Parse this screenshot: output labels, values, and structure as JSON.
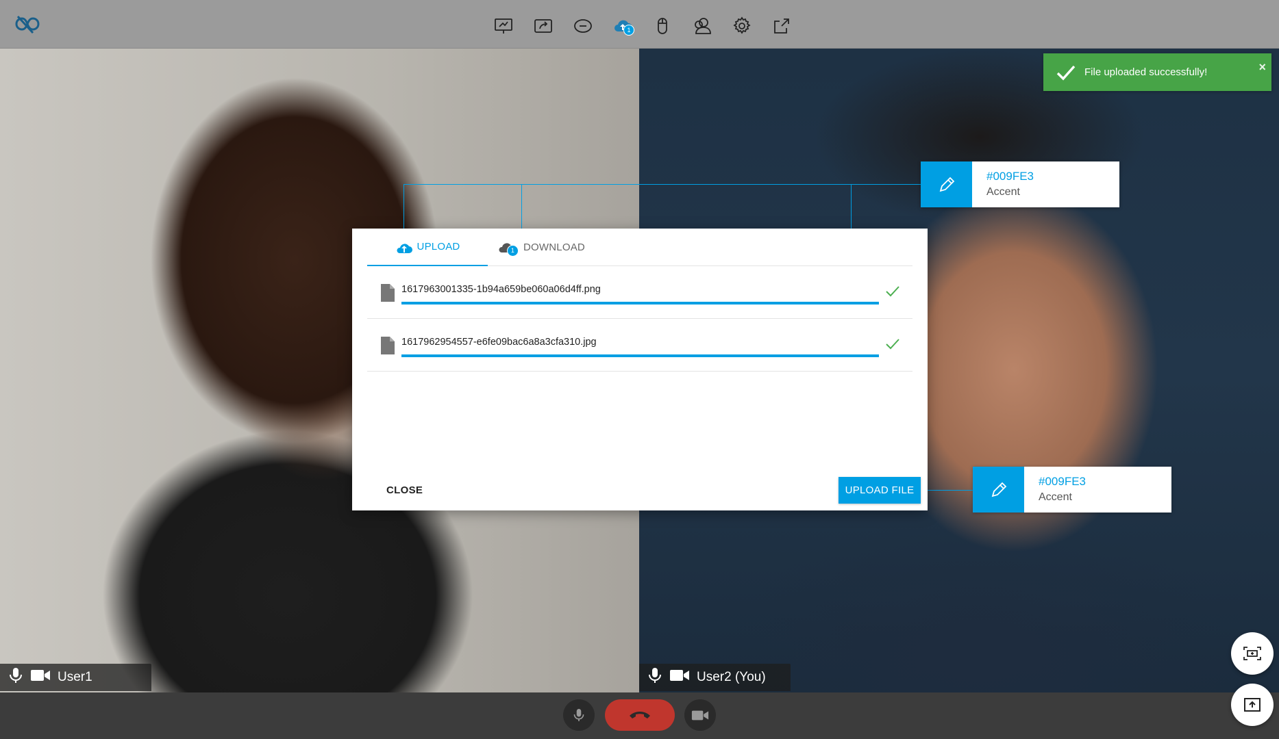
{
  "toolbar": {
    "tools": [
      {
        "name": "whiteboard-icon"
      },
      {
        "name": "share-screen-icon"
      },
      {
        "name": "chat-icon"
      },
      {
        "name": "file-transfer-icon",
        "badge": "1"
      },
      {
        "name": "mouse-icon"
      },
      {
        "name": "participants-icon"
      },
      {
        "name": "settings-icon"
      },
      {
        "name": "fullscreen-icon"
      }
    ]
  },
  "toast": {
    "message": "File uploaded successfully!",
    "close": "×"
  },
  "participants": [
    {
      "name": "User1"
    },
    {
      "name": "User2 (You)"
    }
  ],
  "modal": {
    "tabs": {
      "upload": "UPLOAD",
      "download": "DOWNLOAD",
      "download_badge": "1"
    },
    "files": [
      {
        "name": "1617963001335-1b94a659be060a06d4ff.png",
        "progress": 1.0,
        "status": "done"
      },
      {
        "name": "1617962954557-e6fe09bac6a8a3cfa310.jpg",
        "progress": 1.0,
        "status": "done"
      }
    ],
    "close_label": "CLOSE",
    "upload_label": "UPLOAD FILE"
  },
  "swatches": [
    {
      "hex": "#009FE3",
      "label": "Accent"
    },
    {
      "hex": "#009FE3",
      "label": "Accent"
    }
  ],
  "colors": {
    "accent": "#009FE3",
    "success": "#47a447",
    "hangup": "#c0362d",
    "topbar": "#9b9b9b"
  }
}
